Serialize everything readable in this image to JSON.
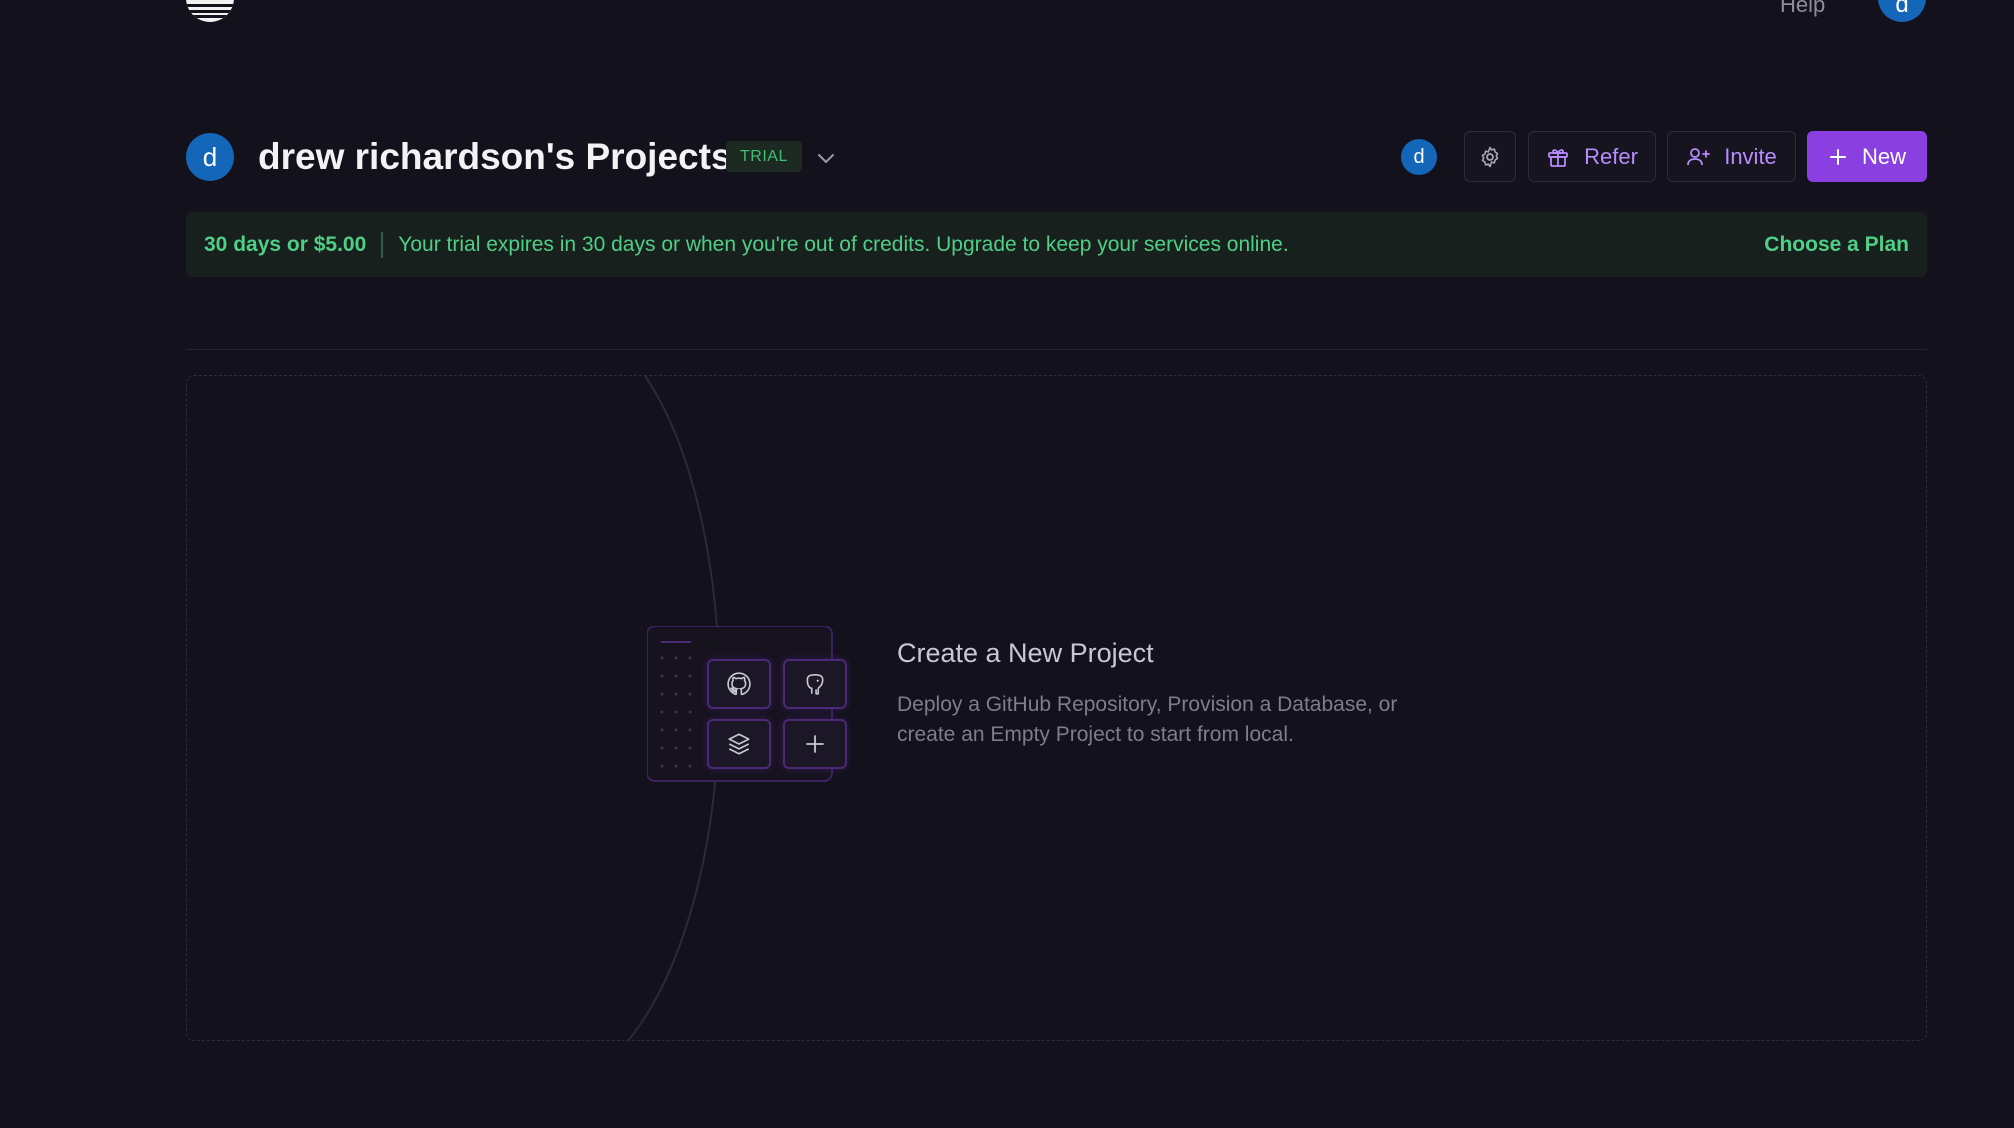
{
  "nav": {
    "help_label": "Help",
    "user_initial": "d"
  },
  "header": {
    "avatar_initial": "d",
    "title": "drew richardson's Projects",
    "plan_badge": "TRIAL",
    "member_initial": "d",
    "refer_label": "Refer",
    "invite_label": "Invite",
    "new_label": "New"
  },
  "banner": {
    "amount": "30 days or $5.00",
    "message": "Your trial expires in 30 days or when you're out of credits. Upgrade to keep your services online.",
    "cta": "Choose a Plan"
  },
  "empty_state": {
    "title": "Create a New Project",
    "description": "Deploy a GitHub Repository, Provision a Database, or create an Empty Project to start from local.",
    "tiles": [
      "github-icon",
      "postgres-icon",
      "layers-icon",
      "plus-icon"
    ]
  },
  "colors": {
    "background": "#13111c",
    "accent": "#8a3fe0",
    "success": "#4fcf86",
    "avatar": "#1466b8"
  }
}
